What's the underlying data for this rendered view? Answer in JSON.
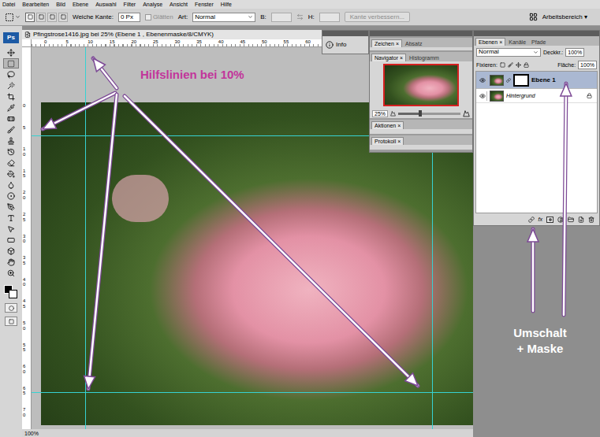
{
  "menu": [
    "Datei",
    "Bearbeiten",
    "Bild",
    "Ebene",
    "Auswahl",
    "Filter",
    "Analyse",
    "Ansicht",
    "Fenster",
    "Hilfe"
  ],
  "options_bar": {
    "selection_modes": [
      {
        "selected": true
      },
      {
        "selected": false
      },
      {
        "selected": false
      },
      {
        "selected": false
      }
    ],
    "feather_label": "Weiche Kante:",
    "feather_value": "0 Px",
    "antialias_label": "Glätten",
    "antialias_checked": false,
    "antialias_disabled": true,
    "style_label": "Art:",
    "style_value": "Normal",
    "width_label": "B:",
    "height_label": "H:",
    "refine_edge": "Kante verbessern...",
    "refine_edge_disabled": true,
    "workspace": "Arbeitsbereich ▾"
  },
  "toolbar": {
    "logo": "Ps",
    "tools": [
      {
        "selected": false
      },
      {
        "selected": true
      },
      {
        "selected": false
      },
      {
        "selected": false
      },
      {
        "selected": false
      },
      {
        "selected": false
      },
      {
        "selected": false
      },
      {
        "selected": false
      },
      {
        "selected": false
      },
      {
        "selected": false
      },
      {
        "selected": false
      },
      {
        "selected": false
      },
      {
        "selected": false
      },
      {
        "selected": false
      },
      {
        "selected": false
      },
      {
        "selected": false
      },
      {
        "selected": false
      },
      {
        "selected": false
      },
      {
        "selected": false
      },
      {
        "selected": false
      },
      {
        "selected": false
      }
    ]
  },
  "document": {
    "title": "Pfingstrose1416.jpg bei 25% (Ebene 1 , Ebenenmaske/8/CMYK)",
    "ruler_top": [
      "0",
      "5",
      "10",
      "15",
      "20",
      "25",
      "30",
      "35",
      "40",
      "45",
      "50",
      "55",
      "60"
    ],
    "ruler_left": [
      "0",
      "5",
      "10",
      "15",
      "20",
      "25",
      "30",
      "35",
      "40",
      "45",
      "50",
      "55",
      "60",
      "65",
      "70"
    ],
    "zoom": "100%"
  },
  "annotations": {
    "guides_label": "Hilfslinien bei 10%",
    "shortcut_label": [
      "Umschalt",
      "+ Maske"
    ]
  },
  "tab_close": "×",
  "info_panel": {
    "title": "Info"
  },
  "character_panel": {
    "tabs": [
      {
        "label": "Zeichen",
        "selected": true
      },
      {
        "label": "Absatz",
        "selected": false
      }
    ]
  },
  "navigator_panel": {
    "tabs": [
      {
        "label": "Navigator",
        "selected": true
      },
      {
        "label": "Histogramm",
        "selected": false
      }
    ],
    "zoom": "25%",
    "level": 0.35
  },
  "actions_panel": {
    "tabs": [
      {
        "label": "Aktionen",
        "selected": true
      }
    ]
  },
  "history_panel": {
    "tabs": [
      {
        "label": "Protokoll",
        "selected": true
      }
    ]
  },
  "layers_panel": {
    "tabs": [
      {
        "label": "Ebenen",
        "selected": true
      },
      {
        "label": "Kanäle",
        "selected": false
      },
      {
        "label": "Pfade",
        "selected": false
      }
    ],
    "blend_mode": "Normal",
    "opacity_label": "Deckkr.:",
    "opacity": "100%",
    "lock_label": "Fixieren:",
    "fill_label": "Fläche:",
    "fill": "100%",
    "fx": "fx",
    "layers": [
      {
        "name": "Ebene 1",
        "selected": true,
        "visible": true,
        "kind": "masked",
        "locked": false
      },
      {
        "name": "Hintergrund",
        "selected": false,
        "visible": true,
        "kind": "background",
        "locked": true
      }
    ]
  }
}
